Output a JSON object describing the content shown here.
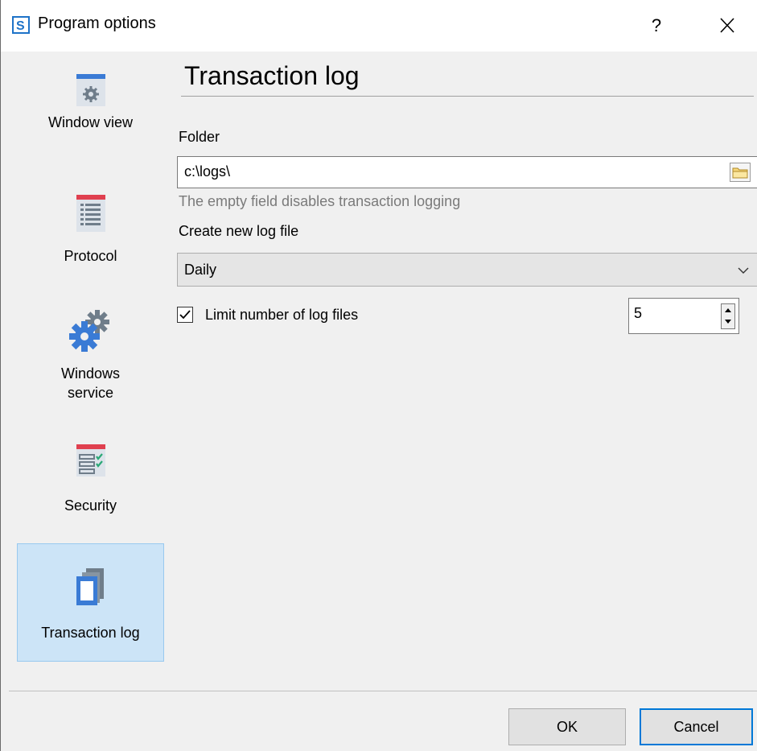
{
  "window": {
    "title": "Program options",
    "help_label": "?"
  },
  "nav": {
    "items": [
      {
        "label": "Window view"
      },
      {
        "label": "Protocol"
      },
      {
        "label": "Windows service"
      },
      {
        "label": "Security"
      },
      {
        "label": "Transaction log",
        "selected": true
      }
    ]
  },
  "page": {
    "title": "Transaction log",
    "folder_label": "Folder",
    "folder_value": "c:\\logs\\",
    "folder_hint": "The empty field disables transaction logging",
    "create_label": "Create new log file",
    "create_value": "Daily",
    "limit_label": "Limit number of log files",
    "limit_checked": true,
    "limit_value": "5"
  },
  "footer": {
    "ok_label": "OK",
    "cancel_label": "Cancel"
  },
  "colors": {
    "accent": "#0078d7",
    "selected_bg": "#cce4f7",
    "icon_blue": "#3a7bd5",
    "icon_red": "#e0404f"
  }
}
